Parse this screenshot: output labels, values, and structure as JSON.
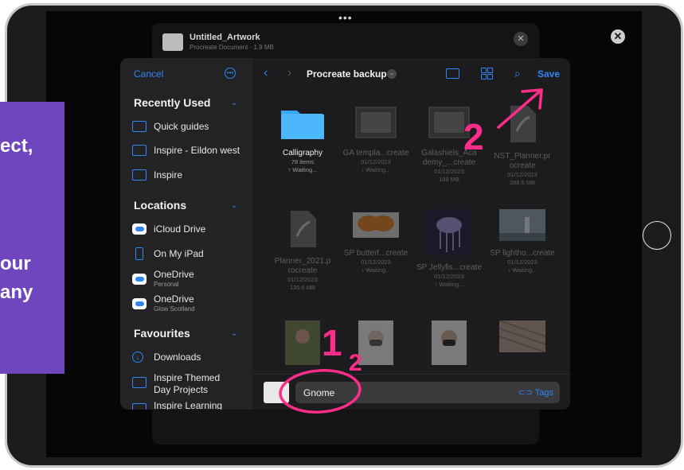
{
  "background_document": {
    "title": "Untitled_Artwork",
    "subtitle": "Procreate Document · 1.9 MB",
    "close_icon": "close-icon"
  },
  "side_panel_text": [
    "ect,",
    "our",
    "any"
  ],
  "sidebar": {
    "cancel_label": "Cancel",
    "more_icon": "ellipsis-circle-icon",
    "sections": {
      "recently_used": "Recently Used",
      "locations": "Locations",
      "favourites": "Favourites"
    },
    "recent_items": [
      {
        "label": "Quick guides",
        "icon": "folder-icon"
      },
      {
        "label": "Inspire - Eildon west",
        "icon": "shared-folder-icon"
      },
      {
        "label": "Inspire",
        "icon": "folder-icon"
      }
    ],
    "locations": [
      {
        "label": "iCloud Drive",
        "sub": "",
        "icon": "icloud-icon"
      },
      {
        "label": "On My iPad",
        "sub": "",
        "icon": "ipad-icon"
      },
      {
        "label": "OneDrive",
        "sub": "Personal",
        "icon": "onedrive-icon"
      },
      {
        "label": "OneDrive",
        "sub": "Glow Scotland",
        "icon": "onedrive-icon"
      }
    ],
    "favourites": [
      {
        "label": "Downloads",
        "icon": "download-icon"
      },
      {
        "label": "Inspire Themed Day Projects",
        "icon": "shared-folder-icon"
      },
      {
        "label": "Inspire Learning",
        "icon": "shared-folder-icon"
      }
    ]
  },
  "toolbar": {
    "folder_title": "Procreate backup",
    "save_label": "Save"
  },
  "files": [
    {
      "name": "Calligraphy",
      "meta1": "78 items",
      "meta2": "↑ Waiting...",
      "kind": "folder",
      "dim": false
    },
    {
      "name": "GA templa...create",
      "meta1": "01/12/2023",
      "meta2": "↑ Waiting...",
      "kind": "image",
      "dim": true
    },
    {
      "name": "Galashiels_Aca demy_...create",
      "meta1": "01/12/2023",
      "meta2": "189 MB",
      "kind": "image",
      "dim": true
    },
    {
      "name": "NST_Planner.pr ocreate",
      "meta1": "01/12/2023",
      "meta2": "288.5 MB",
      "kind": "doc",
      "dim": true
    },
    {
      "name": "Planner_2021.p rocreate",
      "meta1": "01/12/2023",
      "meta2": "135.6 MB",
      "kind": "doc",
      "dim": true
    },
    {
      "name": "SP butterf...create",
      "meta1": "01/12/2023",
      "meta2": "↑ Waiting...",
      "kind": "butterfly",
      "dim": true
    },
    {
      "name": "SP Jellyfis...create",
      "meta1": "01/12/2023",
      "meta2": "↑ Waiting...",
      "kind": "jellyfish",
      "dim": true
    },
    {
      "name": "SP lightho...create",
      "meta1": "01/12/2023",
      "meta2": "↑ Waiting...",
      "kind": "lighthouse",
      "dim": true
    },
    {
      "name": "",
      "meta1": "",
      "meta2": "",
      "kind": "person1",
      "dim": true
    },
    {
      "name": "",
      "meta1": "",
      "meta2": "",
      "kind": "person2",
      "dim": true
    },
    {
      "name": "",
      "meta1": "",
      "meta2": "",
      "kind": "person3",
      "dim": true
    },
    {
      "name": "",
      "meta1": "",
      "meta2": "",
      "kind": "pattern",
      "dim": true
    }
  ],
  "filename_bar": {
    "value": "Gnome",
    "tags_label": "Tags"
  },
  "annotations": {
    "step1_label": "1",
    "step2_label": "2",
    "color": "#ff2d8a"
  },
  "colors": {
    "accent": "#2f86f5",
    "panel": "#6f46bd"
  }
}
